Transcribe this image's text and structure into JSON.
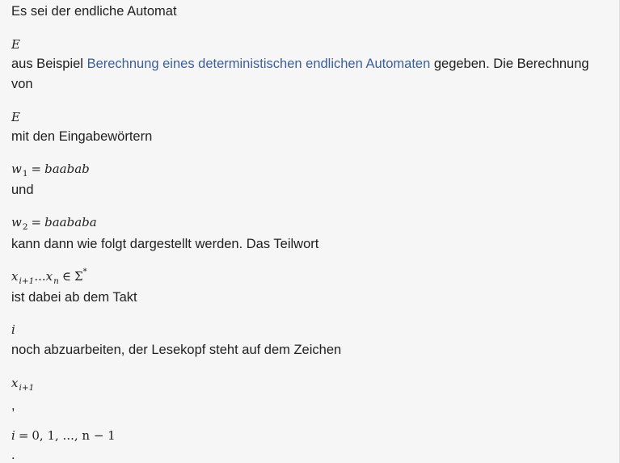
{
  "text": {
    "line1": "Es sei der endliche Automat",
    "line2_pre": "aus Beispiel ",
    "line2_link": "Berechnung eines deterministischen endlichen Automaten",
    "line2_post": " gegeben. Die Berechnung",
    "line3": "von",
    "line4": "mit den Eingabewörtern",
    "line5": "und",
    "line6": "kann dann wie folgt dargestellt werden. Das Teilwort",
    "line7": "ist dabei ab dem Takt",
    "line8": "noch abzuarbeiten, der Lesekopf steht auf dem Zeichen",
    "comma": ",",
    "period": "."
  },
  "math": {
    "E": "E",
    "w": "w",
    "w1_sub": "1",
    "eq": "=",
    "w1_val": "baabab",
    "w2_sub": "2",
    "w2_val": "baababa",
    "x": "x",
    "i1_sub": "i+1",
    "dots": "...",
    "n_sub": "n",
    "in": "∈",
    "sigma": "Σ",
    "star": "*",
    "i": "i",
    "range": "0, 1, ..., n − 1"
  }
}
